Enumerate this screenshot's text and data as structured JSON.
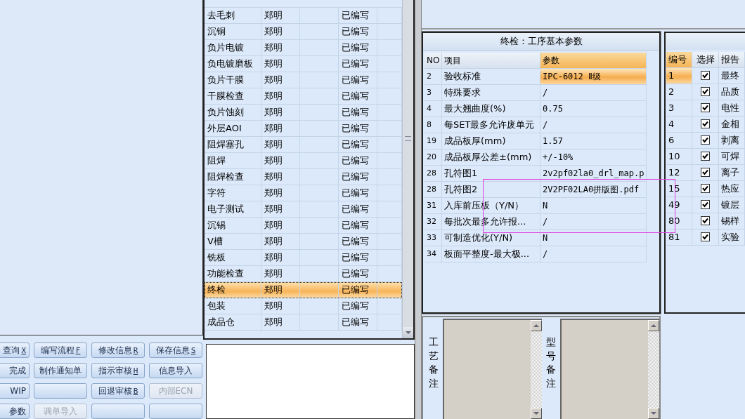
{
  "buttons": [
    {
      "label": "查询",
      "hotkey": "X",
      "disabled": false
    },
    {
      "label": "编写流程",
      "hotkey": "F",
      "disabled": false
    },
    {
      "label": "修改信息",
      "hotkey": "R",
      "disabled": false
    },
    {
      "label": "保存信息",
      "hotkey": "S",
      "disabled": false
    },
    {
      "label": "完成",
      "disabled": false
    },
    {
      "label": "制作通知单",
      "disabled": false
    },
    {
      "label": "指示审核",
      "hotkey": "H",
      "disabled": false
    },
    {
      "label": "信息导入",
      "disabled": false
    },
    {
      "label": "WIP",
      "disabled": false
    },
    {
      "disabled": false
    },
    {
      "label": "回退审核",
      "hotkey": "B",
      "disabled": false
    },
    {
      "label": "内部ECN",
      "disabled": true
    },
    {
      "label": "参数",
      "disabled": false
    },
    {
      "label": "调单导入",
      "disabled": true
    },
    {
      "disabled": false
    },
    {
      "disabled": false
    }
  ],
  "process_table": {
    "rows": [
      {
        "name": "去毛刺",
        "owner": "郑明",
        "status": "已编写",
        "selected": false
      },
      {
        "name": "沉铜",
        "owner": "郑明",
        "status": "已编写",
        "selected": false
      },
      {
        "name": "负片电镀",
        "owner": "郑明",
        "status": "已编写",
        "selected": false
      },
      {
        "name": "负电镀磨板",
        "owner": "郑明",
        "status": "已编写",
        "selected": false
      },
      {
        "name": "负片干膜",
        "owner": "郑明",
        "status": "已编写",
        "selected": false
      },
      {
        "name": "干膜检查",
        "owner": "郑明",
        "status": "已编写",
        "selected": false
      },
      {
        "name": "负片蚀刻",
        "owner": "郑明",
        "status": "已编写",
        "selected": false
      },
      {
        "name": "外层AOI",
        "owner": "郑明",
        "status": "已编写",
        "selected": false
      },
      {
        "name": "阻焊塞孔",
        "owner": "郑明",
        "status": "已编写",
        "selected": false
      },
      {
        "name": "阻焊",
        "owner": "郑明",
        "status": "已编写",
        "selected": false
      },
      {
        "name": "阻焊检查",
        "owner": "郑明",
        "status": "已编写",
        "selected": false
      },
      {
        "name": "字符",
        "owner": "郑明",
        "status": "已编写",
        "selected": false
      },
      {
        "name": "电子测试",
        "owner": "郑明",
        "status": "已编写",
        "selected": false
      },
      {
        "name": "沉锡",
        "owner": "郑明",
        "status": "已编写",
        "selected": false
      },
      {
        "name": "V槽",
        "owner": "郑明",
        "status": "已编写",
        "selected": false
      },
      {
        "name": "铣板",
        "owner": "郑明",
        "status": "已编写",
        "selected": false
      },
      {
        "name": "功能检查",
        "owner": "郑明",
        "status": "已编写",
        "selected": false
      },
      {
        "name": "终检",
        "owner": "郑明",
        "status": "已编写",
        "selected": true
      },
      {
        "name": "包装",
        "owner": "郑明",
        "status": "已编写",
        "selected": false
      },
      {
        "name": "成品仓",
        "owner": "郑明",
        "status": "已编写",
        "selected": false
      }
    ]
  },
  "params_panel": {
    "title": "终检：工序基本参数",
    "columns": [
      {
        "label": "NO",
        "selected": false
      },
      {
        "label": "项目",
        "selected": false
      },
      {
        "label": "参数",
        "selected": true
      }
    ],
    "rows": [
      {
        "no": "2",
        "item": "验收标准",
        "value": "IPC-6012 Ⅱ级",
        "selected": true
      },
      {
        "no": "3",
        "item": "特殊要求",
        "value": "/",
        "selected": false
      },
      {
        "no": "4",
        "item": "最大翘曲度(%)",
        "value": "0.75",
        "selected": false
      },
      {
        "no": "8",
        "item": "每SET最多允许废单元",
        "value": "/",
        "selected": false
      },
      {
        "no": "19",
        "item": "成品板厚(mm)",
        "value": "1.57",
        "selected": false
      },
      {
        "no": "20",
        "item": "成品板厚公差±(mm)",
        "value": "+/-10%",
        "selected": false
      },
      {
        "no": "28",
        "item": "孔符图1",
        "value": "2v2pf02la0_drl_map.p",
        "selected": false
      },
      {
        "no": "28",
        "item": "孔符图2",
        "value": "2V2PF02LA0拼版图.pdf",
        "selected": false
      },
      {
        "no": "31",
        "item": "入库前压板（Y/N）",
        "value": "N",
        "selected": false
      },
      {
        "no": "32",
        "item": "每批次最多允许报...",
        "value": "/",
        "selected": false
      },
      {
        "no": "33",
        "item": "可制造优化(Y/N)",
        "value": "N",
        "selected": false
      },
      {
        "no": "34",
        "item": "板面平整度-最大极...",
        "value": "/",
        "selected": false
      }
    ]
  },
  "reports_panel": {
    "columns": [
      {
        "label": "编号",
        "selected": true
      },
      {
        "label": "选择",
        "selected": false
      },
      {
        "label": "报告",
        "selected": false
      }
    ],
    "rows": [
      {
        "no": "1",
        "checked": true,
        "name": "最终",
        "selected": true
      },
      {
        "no": "2",
        "checked": true,
        "name": "品质",
        "selected": false
      },
      {
        "no": "3",
        "checked": true,
        "name": "电性",
        "selected": false
      },
      {
        "no": "4",
        "checked": true,
        "name": "金相",
        "selected": false
      },
      {
        "no": "6",
        "checked": true,
        "name": "剥离",
        "selected": false
      },
      {
        "no": "10",
        "checked": true,
        "name": "可焊",
        "selected": false
      },
      {
        "no": "12",
        "checked": true,
        "name": "离子",
        "selected": false
      },
      {
        "no": "15",
        "checked": true,
        "name": "热应",
        "selected": false
      },
      {
        "no": "49",
        "checked": true,
        "name": "镀层",
        "selected": false
      },
      {
        "no": "80",
        "checked": true,
        "name": "锡样",
        "selected": false
      },
      {
        "no": "81",
        "checked": true,
        "name": "实验",
        "selected": false
      }
    ]
  },
  "remarks": [
    {
      "label": "工艺备注"
    },
    {
      "label": "型号备注"
    }
  ]
}
